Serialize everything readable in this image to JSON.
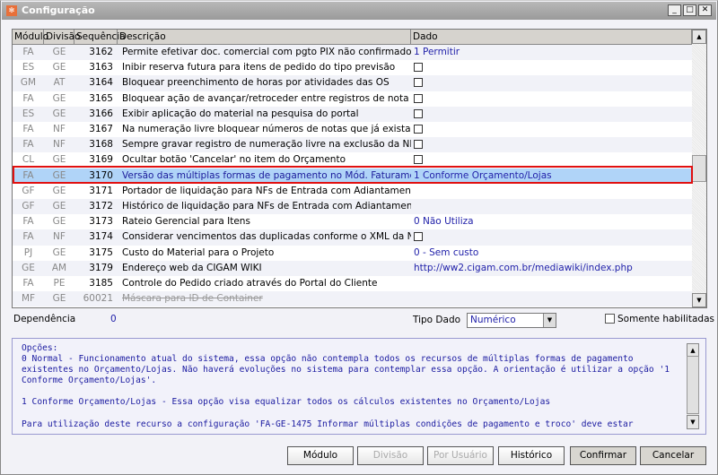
{
  "window": {
    "title": "Configuração"
  },
  "grid": {
    "columns": [
      "Módulo",
      "Divisão",
      "Sequência",
      "Descrição",
      "Dado"
    ],
    "rows": [
      {
        "modulo": "FA",
        "divisao": "GE",
        "seq": "3162",
        "desc": "Permite efetivar doc. comercial com pgto PIX não confirmado",
        "dado": "1 Permitir",
        "type": "text"
      },
      {
        "modulo": "ES",
        "divisao": "GE",
        "seq": "3163",
        "desc": "Inibir reserva futura para itens de pedido do tipo previsão",
        "dado": "",
        "type": "check"
      },
      {
        "modulo": "GM",
        "divisao": "AT",
        "seq": "3164",
        "desc": "Bloquear preenchimento de horas por atividades das OS",
        "dado": "",
        "type": "check"
      },
      {
        "modulo": "FA",
        "divisao": "GE",
        "seq": "3165",
        "desc": "Bloquear ação de avançar/retroceder entre registros de nota",
        "dado": "",
        "type": "check"
      },
      {
        "modulo": "ES",
        "divisao": "GE",
        "seq": "3166",
        "desc": "Exibir aplicação do material na pesquisa do portal",
        "dado": "",
        "type": "check"
      },
      {
        "modulo": "FA",
        "divisao": "NF",
        "seq": "3167",
        "desc": "Na numeração livre bloquear números de notas que já existam",
        "dado": "",
        "type": "check"
      },
      {
        "modulo": "FA",
        "divisao": "NF",
        "seq": "3168",
        "desc": "Sempre gravar registro de numeração livre na exclusão da NF",
        "dado": "",
        "type": "check"
      },
      {
        "modulo": "CL",
        "divisao": "GE",
        "seq": "3169",
        "desc": "Ocultar botão 'Cancelar' no item do Orçamento",
        "dado": "",
        "type": "check"
      },
      {
        "modulo": "FA",
        "divisao": "GE",
        "seq": "3170",
        "desc": "Versão das múltiplas formas de pagamento no Mód. Faturamento",
        "dado": "1 Conforme Orçamento/Lojas",
        "type": "text",
        "selected": true
      },
      {
        "modulo": "GF",
        "divisao": "GE",
        "seq": "3171",
        "desc": "Portador de liquidação para NFs de Entrada com Adiantamento",
        "dado": "",
        "type": "text"
      },
      {
        "modulo": "GF",
        "divisao": "GE",
        "seq": "3172",
        "desc": "Histórico de liquidação para NFs de Entrada com Adiantamento",
        "dado": "",
        "type": "text"
      },
      {
        "modulo": "FA",
        "divisao": "GE",
        "seq": "3173",
        "desc": "Rateio Gerencial para Itens",
        "dado": "0 Não Utiliza",
        "type": "text"
      },
      {
        "modulo": "FA",
        "divisao": "NF",
        "seq": "3174",
        "desc": "Considerar vencimentos das duplicadas conforme o XML da NFe",
        "dado": "",
        "type": "check"
      },
      {
        "modulo": "PJ",
        "divisao": "GE",
        "seq": "3175",
        "desc": "Custo do Material para o Projeto",
        "dado": "0 - Sem custo",
        "type": "text"
      },
      {
        "modulo": "GE",
        "divisao": "AM",
        "seq": "3179",
        "desc": "Endereço web da CIGAM WIKI",
        "dado": "http://ww2.cigam.com.br/mediawiki/index.php",
        "type": "text"
      },
      {
        "modulo": "FA",
        "divisao": "PE",
        "seq": "3185",
        "desc": "Controle do Pedido criado através do Portal do Cliente",
        "dado": "",
        "type": "text"
      },
      {
        "modulo": "MF",
        "divisao": "GE",
        "seq": "60021",
        "desc": "Máscara para ID de Container",
        "dado": "",
        "type": "text",
        "disabled": true
      }
    ]
  },
  "footer": {
    "dependencia_label": "Dependência",
    "dependencia_value": "0",
    "tipo_dado_label": "Tipo Dado",
    "tipo_dado_value": "Numérico",
    "somente_label": "Somente habilitadas"
  },
  "options_text": "Opções:\n0 Normal - Funcionamento atual do sistema, essa opção não contempla todos os recursos de múltiplas formas de pagamento existentes no Orçamento/Lojas. Não haverá evoluções no sistema para contemplar essa opção. A orientação é utilizar a opção '1 Conforme Orçamento/Lojas'.\n\n1 Conforme Orçamento/Lojas - Essa opção visa equalizar todos os cálculos existentes no Orçamento/Lojas\n\nPara utilização deste recurso a configuração 'FA-GE-1475 Informar múltiplas condições de pagamento e troco' deve estar",
  "buttons": {
    "modulo": "Módulo",
    "divisao": "Divisão",
    "por_usuario": "Por Usuário",
    "historico": "Histórico",
    "confirmar": "Confirmar",
    "cancelar": "Cancelar"
  }
}
